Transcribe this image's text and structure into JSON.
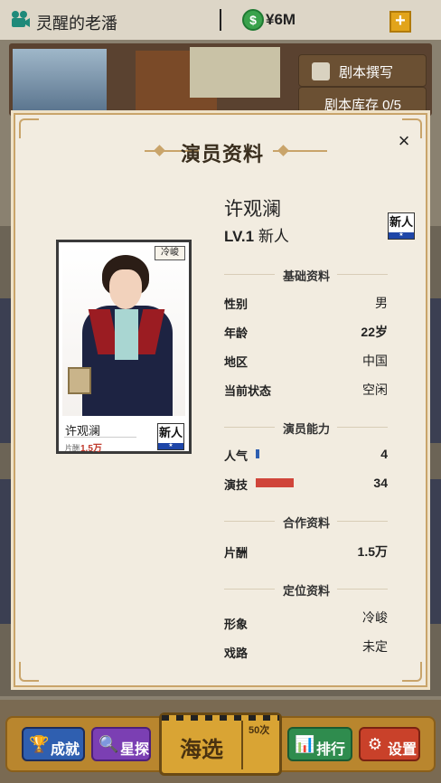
{
  "topbar": {
    "title": "灵醒的老潘",
    "money": "¥6M",
    "coin_icon": "dollar-coin-icon",
    "plus": "+"
  },
  "side_menu": {
    "script_write": "剧本撰写",
    "script_stock": "剧本库存 0/5"
  },
  "modal": {
    "title": "演员资料",
    "close": "×",
    "card": {
      "tag": "冷峻",
      "name": "许观澜",
      "fee_label": "片酬",
      "fee": "1.5万",
      "badge": "新人",
      "badge_star": "★"
    },
    "actor": {
      "name": "许观澜",
      "level": "LV.1",
      "rank": "新人",
      "badge": "新人",
      "badge_star": "★"
    },
    "sections": {
      "basic": "基础资料",
      "ability": "演员能力",
      "cooperation": "合作资料",
      "positioning": "定位资料"
    },
    "basic": {
      "gender_label": "性别",
      "gender": "男",
      "age_label": "年龄",
      "age": "22岁",
      "region_label": "地区",
      "region": "中国",
      "status_label": "当前状态",
      "status": "空闲"
    },
    "ability": {
      "popularity_label": "人气",
      "popularity": "4",
      "acting_label": "演技",
      "acting": "34",
      "popularity_color": "#2f5fb0",
      "acting_color": "#d0453a"
    },
    "cooperation": {
      "fee_label": "片酬",
      "fee": "1.5万"
    },
    "positioning": {
      "image_label": "形象",
      "image": "冷峻",
      "role_label": "戏路",
      "role": "未定"
    }
  },
  "bottom_nav": {
    "achievements": "成就",
    "scout": "星探",
    "audition": "海选",
    "audition_count": "50次",
    "ranking": "排行",
    "settings": "设置"
  }
}
